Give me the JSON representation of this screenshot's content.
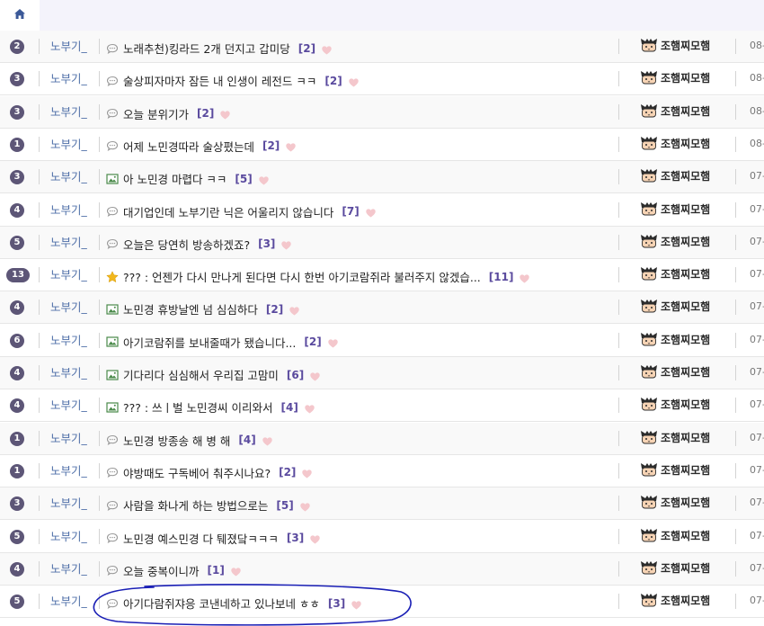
{
  "nav": {
    "home_icon": "home-icon"
  },
  "colors": {
    "badge": "#5d5677",
    "nick": "#4f6fa8",
    "comment_count": "#5a4a9e",
    "heart": "#f4c7cc",
    "annotation": "#1a1fb5"
  },
  "author_name": "조햄찌모햄",
  "rows": [
    {
      "num": "2",
      "nick": "노부기_",
      "icon": "speech-bubble-icon",
      "title": "노래추천)킹라드 2개 던지고 갑미당",
      "comments": "[2]",
      "date": "08-"
    },
    {
      "num": "3",
      "nick": "노부기_",
      "icon": "speech-bubble-icon",
      "title": "술상피자마자 잠든 내 인생이 레전드 ㅋㅋ",
      "comments": "[2]",
      "date": "08-"
    },
    {
      "num": "3",
      "nick": "노부기_",
      "icon": "speech-bubble-icon",
      "title": "오늘 분위기가",
      "comments": "[2]",
      "date": "08-"
    },
    {
      "num": "1",
      "nick": "노부기_",
      "icon": "speech-bubble-icon",
      "title": "어제 노민경따라 술상폈는데",
      "comments": "[2]",
      "date": "08-"
    },
    {
      "num": "3",
      "nick": "노부기_",
      "icon": "image-icon",
      "title": "아 노민경 마렵다 ㅋㅋ",
      "comments": "[5]",
      "date": "07-"
    },
    {
      "num": "4",
      "nick": "노부기_",
      "icon": "speech-bubble-icon",
      "title": "대기업인데 노부기란 닉은 어울리지 않습니다",
      "comments": "[7]",
      "date": "07-"
    },
    {
      "num": "5",
      "nick": "노부기_",
      "icon": "speech-bubble-icon",
      "title": "오늘은 당연히 방송하겠죠?",
      "comments": "[3]",
      "date": "07-"
    },
    {
      "num": "13",
      "nick": "노부기_",
      "icon": "star-icon",
      "title": "??? : 언젠가 다시 만나게 된다면 다시 한번 아기코람쥐라 불러주지 않겠습...",
      "comments": "[11]",
      "date": "07-"
    },
    {
      "num": "4",
      "nick": "노부기_",
      "icon": "image-icon",
      "title": "노민경 휴방날엔 넘 심심하다",
      "comments": "[2]",
      "date": "07-"
    },
    {
      "num": "6",
      "nick": "노부기_",
      "icon": "image-icon",
      "title": "아기코람쥐를 보내줄때가 됐습니다...",
      "comments": "[2]",
      "date": "07-"
    },
    {
      "num": "4",
      "nick": "노부기_",
      "icon": "image-icon",
      "title": "기다리다 심심해서 우리집 고맘미",
      "comments": "[6]",
      "date": "07-"
    },
    {
      "num": "4",
      "nick": "노부기_",
      "icon": "image-icon",
      "title": "??? : 쓰ㅣ벌 노민경씨 이리와서",
      "comments": "[4]",
      "date": "07-"
    },
    {
      "num": "1",
      "nick": "노부기_",
      "icon": "speech-bubble-icon",
      "title": "노민경 방종송 해 병 해",
      "comments": "[4]",
      "date": "07-"
    },
    {
      "num": "1",
      "nick": "노부기_",
      "icon": "speech-bubble-icon",
      "title": "야방때도 구독베어 춰주시나요?",
      "comments": "[2]",
      "date": "07-"
    },
    {
      "num": "3",
      "nick": "노부기_",
      "icon": "speech-bubble-icon",
      "title": "사람을 화나게 하는 방법으로는",
      "comments": "[5]",
      "date": "07-"
    },
    {
      "num": "5",
      "nick": "노부기_",
      "icon": "speech-bubble-icon",
      "title": "노민경 예스민경 다 퉤졌닼ㅋㅋㅋ",
      "comments": "[3]",
      "date": "07-"
    },
    {
      "num": "4",
      "nick": "노부기_",
      "icon": "speech-bubble-icon",
      "title": "오늘 중복이니까",
      "comments": "[1]",
      "date": "07-"
    },
    {
      "num": "5",
      "nick": "노부기_",
      "icon": "speech-bubble-icon",
      "title": "아기다람쥐쟈응 코낸네하고 있나보네 ㅎㅎ",
      "comments": "[3]",
      "date": "07-"
    }
  ]
}
